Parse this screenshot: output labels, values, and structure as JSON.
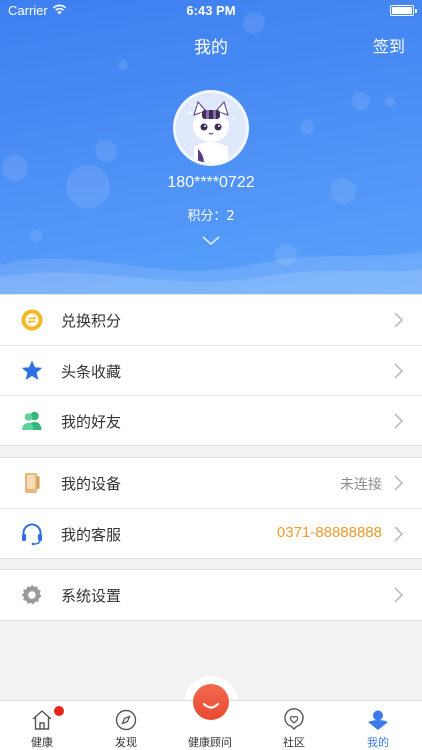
{
  "status_bar": {
    "carrier": "Carrier",
    "time": "6:43 PM"
  },
  "header": {
    "title": "我的",
    "checkin_label": "签到",
    "phone": "180****0722",
    "points": "积分：2"
  },
  "menu_groups": [
    [
      {
        "icon": "exchange-points-icon",
        "label": "兑换积分",
        "value": ""
      },
      {
        "icon": "star-icon",
        "label": "头条收藏",
        "value": ""
      },
      {
        "icon": "friends-icon",
        "label": "我的好友",
        "value": ""
      }
    ],
    [
      {
        "icon": "device-icon",
        "label": "我的设备",
        "value": "未连接"
      },
      {
        "icon": "headset-icon",
        "label": "我的客服",
        "value": "0371-88888888"
      }
    ],
    [
      {
        "icon": "gear-icon",
        "label": "系统设置",
        "value": ""
      }
    ]
  ],
  "tabbar": {
    "tabs": [
      {
        "icon": "home-icon",
        "label": "健康",
        "badge": true
      },
      {
        "icon": "compass-icon",
        "label": "发现"
      },
      {
        "icon": "advisor-icon",
        "label": "健康顾问"
      },
      {
        "icon": "community-icon",
        "label": "社区"
      },
      {
        "icon": "profile-icon",
        "label": "我的",
        "active": true
      }
    ]
  },
  "colors": {
    "accent": "#3b7ae8",
    "phone_value": "#f39a2c",
    "badge": "#e8231c"
  }
}
